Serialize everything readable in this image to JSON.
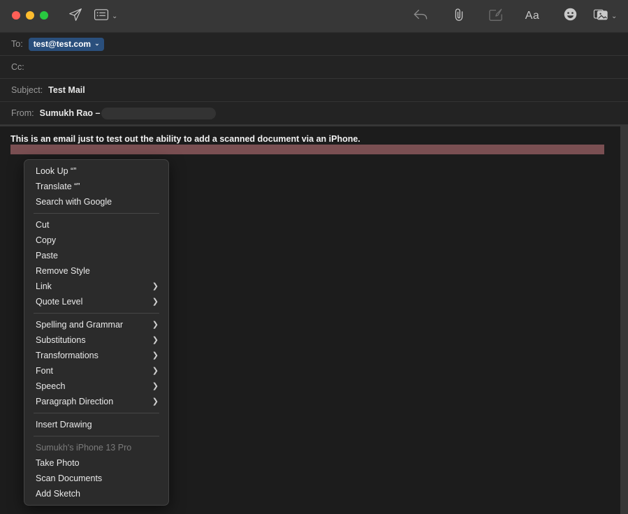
{
  "window": {
    "traffic_lights": [
      {
        "name": "close",
        "color": "#ff5f57"
      },
      {
        "name": "minimize",
        "color": "#febc2e"
      },
      {
        "name": "zoom",
        "color": "#28c840"
      }
    ]
  },
  "toolbar": {
    "send_icon": "send-paper-plane-icon",
    "header_fields_icon": "header-fields-list-icon",
    "header_fields_chevron": "⌄",
    "reply_icon": "reply-arrow-icon",
    "attach_icon": "attachment-paperclip-icon",
    "markup_icon": "markup-and-sign-icon",
    "format_label": "Aa",
    "emoji_icon": "emoji-smiley-icon",
    "photos_icon": "photo-browser-icon",
    "photos_chevron": "⌄"
  },
  "header": {
    "to": {
      "label": "To:",
      "token": "test@test.com",
      "token_chevron": "⌄"
    },
    "cc": {
      "label": "Cc:",
      "value": ""
    },
    "subject": {
      "label": "Subject:",
      "value": "Test Mail"
    },
    "from": {
      "label": "From:",
      "value": "Sumukh Rao –",
      "redacted": true
    }
  },
  "body": {
    "text": "This is an email just to test out the ability to add a scanned document via an iPhone.",
    "selection_color": "#7a4f52"
  },
  "context_menu": {
    "groups": [
      {
        "items": [
          {
            "label": "Look Up “”",
            "submenu": false,
            "disabled": false
          },
          {
            "label": "Translate “”",
            "submenu": false,
            "disabled": false
          },
          {
            "label": "Search with Google",
            "submenu": false,
            "disabled": false
          }
        ]
      },
      {
        "items": [
          {
            "label": "Cut",
            "submenu": false,
            "disabled": false
          },
          {
            "label": "Copy",
            "submenu": false,
            "disabled": false
          },
          {
            "label": "Paste",
            "submenu": false,
            "disabled": false
          },
          {
            "label": "Remove Style",
            "submenu": false,
            "disabled": false
          },
          {
            "label": "Link",
            "submenu": true,
            "disabled": false
          },
          {
            "label": "Quote Level",
            "submenu": true,
            "disabled": false
          }
        ]
      },
      {
        "items": [
          {
            "label": "Spelling and Grammar",
            "submenu": true,
            "disabled": false
          },
          {
            "label": "Substitutions",
            "submenu": true,
            "disabled": false
          },
          {
            "label": "Transformations",
            "submenu": true,
            "disabled": false
          },
          {
            "label": "Font",
            "submenu": true,
            "disabled": false
          },
          {
            "label": "Speech",
            "submenu": true,
            "disabled": false
          },
          {
            "label": "Paragraph Direction",
            "submenu": true,
            "disabled": false
          }
        ]
      },
      {
        "items": [
          {
            "label": "Insert Drawing",
            "submenu": false,
            "disabled": false
          }
        ]
      },
      {
        "items": [
          {
            "label": "Sumukh's iPhone 13 Pro",
            "submenu": false,
            "disabled": true
          },
          {
            "label": "Take Photo",
            "submenu": false,
            "disabled": false
          },
          {
            "label": "Scan Documents",
            "submenu": false,
            "disabled": false
          },
          {
            "label": "Add Sketch",
            "submenu": false,
            "disabled": false
          }
        ]
      }
    ],
    "submenu_chevron": "❯"
  }
}
